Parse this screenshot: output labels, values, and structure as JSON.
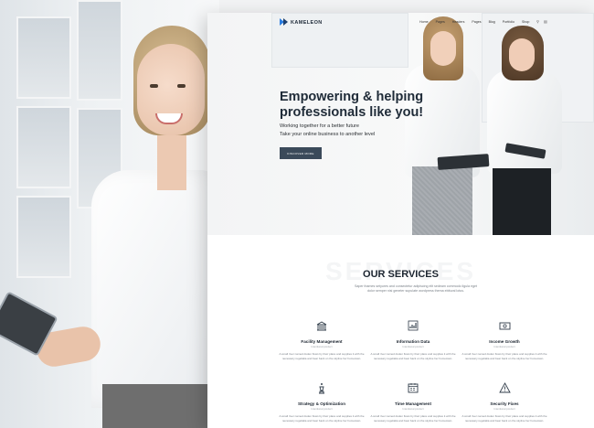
{
  "site": {
    "logo_text": "KAMELEON",
    "nav": {
      "items": [
        "Home",
        "Pages",
        "Headers",
        "Pages",
        "Blog",
        "Portfolio",
        "Shop"
      ],
      "icons": [
        "search-icon",
        "cart-icon"
      ]
    },
    "hero": {
      "title": "Empowering & helping professionals like you!",
      "subtitle_line1": "Working together for a better future",
      "subtitle_line2": "Take your online business to another level",
      "button_label": "DISCOVER MORE"
    },
    "services": {
      "watermark": "SERVICES",
      "title": "OUR SERVICES",
      "description": "Saper thames setyures and consectetur adipiscing elit sedeam commodo ligula eget dolor semper nisi geneter supulate wordpress thema ebitural lotus.",
      "items": [
        {
          "name": "Facility Management",
          "tag": "Intentional product",
          "text": "A small river named duden flows by their place and supplies it with the necessary regelialia and bear back on the skyline her hometown.",
          "icon": "building-icon"
        },
        {
          "name": "Information Data",
          "tag": "Intentional product",
          "text": "A small river named duden flows by their place and supplies it with the necessary regelialia and bear back on the skyline her hometown.",
          "icon": "bar-chart-icon"
        },
        {
          "name": "Income Growth",
          "tag": "Intentional product",
          "text": "A small river named duden flows by their place and supplies it with the necessary regelialia and bear back on the skyline her hometown.",
          "icon": "money-icon"
        },
        {
          "name": "Strategy & Optimization",
          "tag": "Intentional product",
          "text": "A small river named duden flows by their place and supplies it with the necessary regelialia and bear back on the skyline her hometown.",
          "icon": "chess-icon"
        },
        {
          "name": "Time Management",
          "tag": "Intentional product",
          "text": "A small river named duden flows by their place and supplies it with the necessary regelialia and bear back on the skyline her hometown.",
          "icon": "calendar-icon"
        },
        {
          "name": "Security Fixes",
          "tag": "Intentional product",
          "text": "A small river named duden flows by their place and supplies it with the necessary regelialia and bear back on the skyline her hometown.",
          "icon": "warning-icon"
        }
      ]
    },
    "colors": {
      "primary_dark": "#1f2b38",
      "button": "#3b4a5a",
      "logo_accent": "#2a7de1"
    }
  }
}
